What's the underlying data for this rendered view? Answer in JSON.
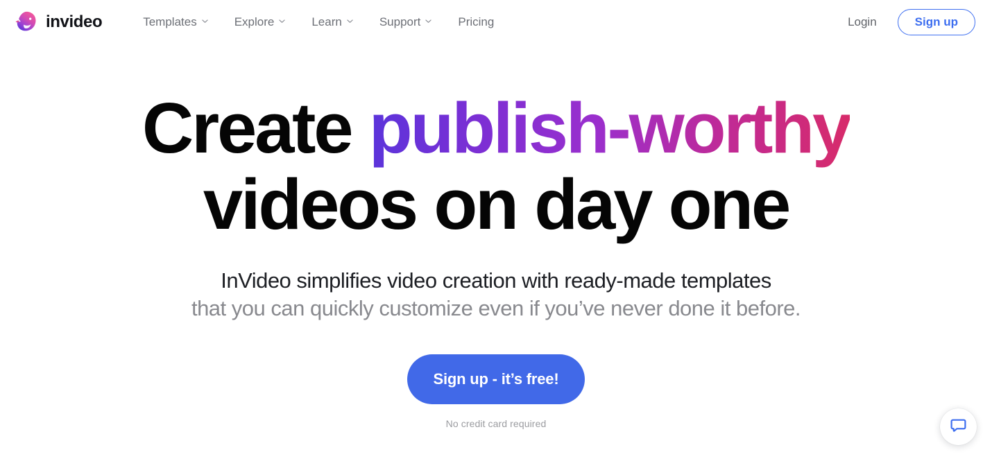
{
  "navbar": {
    "brand": {
      "name": "invideo",
      "logo_icon": "invideo-bird-logo-icon",
      "gradient_from": "#e8589f",
      "gradient_to": "#6a3cd6"
    },
    "links": [
      {
        "label": "Templates",
        "has_dropdown": true,
        "icon": "chevron-down-icon"
      },
      {
        "label": "Explore",
        "has_dropdown": true,
        "icon": "chevron-down-icon"
      },
      {
        "label": "Learn",
        "has_dropdown": true,
        "icon": "chevron-down-icon"
      },
      {
        "label": "Support",
        "has_dropdown": true,
        "icon": "chevron-down-icon"
      },
      {
        "label": "Pricing",
        "has_dropdown": false,
        "icon": ""
      }
    ],
    "login_label": "Login",
    "signup_label": "Sign up",
    "accent_color": "#3d6ef0"
  },
  "hero": {
    "headline_part1": "Create ",
    "headline_gradient": "publish-worthy",
    "headline_line2": "videos on day one",
    "gradient_start": "#5b34db",
    "gradient_end": "#d72b6a",
    "subhead_line1": "InVideo simplifies video creation with ready-made templates",
    "subhead_line2": "that you can quickly customize even if you’ve never done it before.",
    "cta_label": "Sign up - it’s free!",
    "cta_color": "#4169e8",
    "cta_note": "No credit card required"
  },
  "chat": {
    "icon": "chat-bubble-icon",
    "color": "#3d6ef0"
  }
}
